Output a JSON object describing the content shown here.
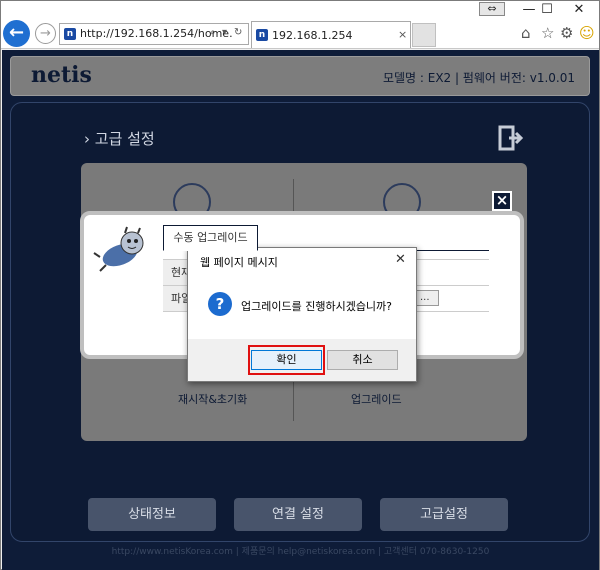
{
  "browser": {
    "url": "http://192.168.1.254/home.",
    "tab_title": "192.168.1.254",
    "tab_close": "×",
    "favicon_letter": "n",
    "minimize": "—",
    "maximize": "☐",
    "close": "✕"
  },
  "header": {
    "logo": "netis",
    "model_info": "모델명 : EX2 | 펌웨어 버전: v1.0.01"
  },
  "section": {
    "title": "› 고급 설정"
  },
  "panel": {
    "left_label": "재시작&초기화",
    "right_label": "업그레이드"
  },
  "upgrade_dialog": {
    "tab_label": "수동 업그레이드",
    "row1_label": "현재",
    "row2_label": "파일",
    "browse_label": "..."
  },
  "message_box": {
    "title": "웹 페이지 메시지",
    "close": "✕",
    "icon_glyph": "?",
    "text": "업그레이드를 진행하시겠습니까?",
    "ok_label": "확인",
    "cancel_label": "취소"
  },
  "nav": {
    "status": "상태정보",
    "connection": "연결 설정",
    "advanced": "고급설정"
  },
  "footer": {
    "text": "http://www.netisKorea.com | 제품문의 help@netiskorea.com | 고객센터 070-8630-1250"
  },
  "colors": {
    "page_bg": "#0e1c38",
    "ok_highlight": "#e01010",
    "accent_blue": "#1c6bcf"
  }
}
